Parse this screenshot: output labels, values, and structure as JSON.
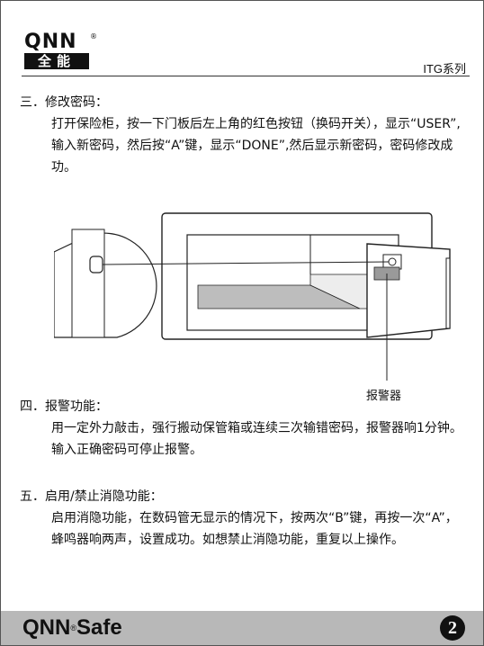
{
  "header": {
    "logo_en": "QNN",
    "logo_registered": "®",
    "logo_cn": "全能",
    "series": "ITG系列"
  },
  "sections": {
    "s3": {
      "title": "三．修改密码：",
      "body": "打开保险柜，按一下门板后左上角的红色按钮（换码开关），显示“USER”,输入新密码，然后按“A”键，显示“DONE”,然后显示新密码，密码修改成功。"
    },
    "s4": {
      "title": "四．报警功能：",
      "body": "用一定外力敲击，强行搬动保管箱或连续三次输错密码，报警器响1分钟。输入正确密码可停止报警。"
    },
    "s5": {
      "title": "五．启用/禁止消隐功能：",
      "body": "启用消隐功能，在数码管无显示的情况下，按两次“B”键，再按一次“A”，蜂鸣器响两声，设置成功。如想禁止消隐功能，重复以上操作。"
    }
  },
  "diagram": {
    "alarm_label": "报警器"
  },
  "footer": {
    "brand": "QNN",
    "registered": "®",
    "brand_suffix": "Safe",
    "page_number": "2"
  }
}
